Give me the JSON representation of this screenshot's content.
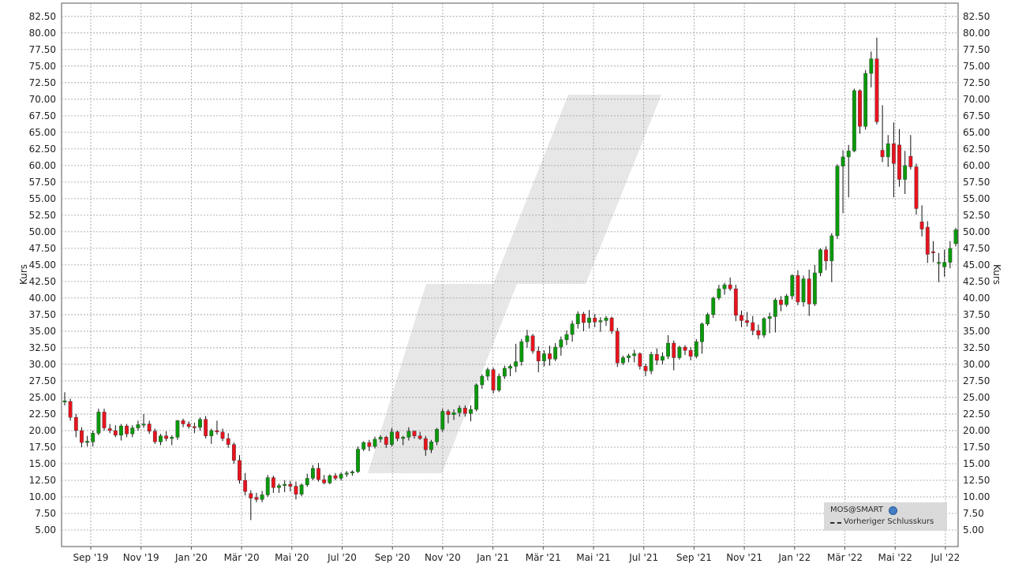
{
  "chart_data": {
    "type": "candlestick",
    "ylabel": "Kurs",
    "ylim": [
      2.5,
      84.5
    ],
    "y_ticks": [
      "5.00",
      "7.50",
      "10.00",
      "12.50",
      "15.00",
      "17.50",
      "20.00",
      "22.50",
      "25.00",
      "27.50",
      "30.00",
      "32.50",
      "35.00",
      "37.50",
      "40.00",
      "42.50",
      "45.00",
      "47.50",
      "50.00",
      "52.50",
      "55.00",
      "57.50",
      "60.00",
      "62.50",
      "65.00",
      "67.50",
      "70.00",
      "72.50",
      "75.00",
      "77.50",
      "80.00",
      "82.50"
    ],
    "x_ticks": [
      "Sep '19",
      "Nov '19",
      "Jan '20",
      "Mär '20",
      "Mai '20",
      "Jul '20",
      "Sep '20",
      "Nov '20",
      "Jan '21",
      "Mär '21",
      "Mai '21",
      "Jul '21",
      "Sep '21",
      "Nov '21",
      "Jan '22",
      "Mär '22",
      "Mai '22",
      "Jul '22"
    ],
    "grid": true,
    "legend_position": "bottom-right",
    "colors": {
      "up": "#0a9a0a",
      "down": "#e8141e",
      "wick": "#111111",
      "grid": "#9a9a9a"
    },
    "candles": [
      [
        24.3,
        25.8,
        23.8,
        24.5
      ],
      [
        24.4,
        24.8,
        21.5,
        22.0
      ],
      [
        22.0,
        22.5,
        19.0,
        20.0
      ],
      [
        20.0,
        20.5,
        17.5,
        18.2
      ],
      [
        18.2,
        19.2,
        17.6,
        18.4
      ],
      [
        18.3,
        20.0,
        17.6,
        19.6
      ],
      [
        19.6,
        23.3,
        19.3,
        22.8
      ],
      [
        22.8,
        23.3,
        20.0,
        20.4
      ],
      [
        20.3,
        21.0,
        19.6,
        20.0
      ],
      [
        20.0,
        20.8,
        19.0,
        19.3
      ],
      [
        19.3,
        21.0,
        18.5,
        20.7
      ],
      [
        20.7,
        21.0,
        19.0,
        19.5
      ],
      [
        19.5,
        20.8,
        19.0,
        20.4
      ],
      [
        20.4,
        21.5,
        20.0,
        20.9
      ],
      [
        20.9,
        22.5,
        20.4,
        21.0
      ],
      [
        21.0,
        21.5,
        19.5,
        19.9
      ],
      [
        19.9,
        20.3,
        18.0,
        18.3
      ],
      [
        18.3,
        19.5,
        17.8,
        19.2
      ],
      [
        19.2,
        19.9,
        18.4,
        18.8
      ],
      [
        18.8,
        19.3,
        17.8,
        19.0
      ],
      [
        19.0,
        21.6,
        18.6,
        21.5
      ],
      [
        21.5,
        21.8,
        20.5,
        21.0
      ],
      [
        21.0,
        21.4,
        20.3,
        20.6
      ],
      [
        20.6,
        21.2,
        19.6,
        20.5
      ],
      [
        20.5,
        22.0,
        20.0,
        21.7
      ],
      [
        21.7,
        22.2,
        18.8,
        19.2
      ],
      [
        19.2,
        20.3,
        18.0,
        20.0
      ],
      [
        20.0,
        21.5,
        19.4,
        19.8
      ],
      [
        19.8,
        20.3,
        18.4,
        18.8
      ],
      [
        18.8,
        19.6,
        17.4,
        17.9
      ],
      [
        17.9,
        18.2,
        15.0,
        15.5
      ],
      [
        15.5,
        16.3,
        12.0,
        12.5
      ],
      [
        12.5,
        13.6,
        10.2,
        10.8
      ],
      [
        10.5,
        11.0,
        6.5,
        9.8
      ],
      [
        9.9,
        10.6,
        9.2,
        9.6
      ],
      [
        9.6,
        10.9,
        9.2,
        10.3
      ],
      [
        10.3,
        13.3,
        10.0,
        12.9
      ],
      [
        12.9,
        13.2,
        10.6,
        11.4
      ],
      [
        11.4,
        12.0,
        10.6,
        11.7
      ],
      [
        11.7,
        12.5,
        10.7,
        11.9
      ],
      [
        11.9,
        12.4,
        10.8,
        11.6
      ],
      [
        11.6,
        12.3,
        9.6,
        10.4
      ],
      [
        10.4,
        12.0,
        10.1,
        11.8
      ],
      [
        11.8,
        13.5,
        11.5,
        12.8
      ],
      [
        12.8,
        14.8,
        12.5,
        14.3
      ],
      [
        14.3,
        15.1,
        12.3,
        12.6
      ],
      [
        12.6,
        13.3,
        11.9,
        12.1
      ],
      [
        12.1,
        13.4,
        11.9,
        13.2
      ],
      [
        13.2,
        13.6,
        12.5,
        12.8
      ],
      [
        12.8,
        13.7,
        12.5,
        13.4
      ],
      [
        13.4,
        13.9,
        13.0,
        13.6
      ],
      [
        13.6,
        14.0,
        13.2,
        13.8
      ],
      [
        13.8,
        17.6,
        13.6,
        17.2
      ],
      [
        17.2,
        18.4,
        16.9,
        18.2
      ],
      [
        18.2,
        18.6,
        16.9,
        17.6
      ],
      [
        17.6,
        19.1,
        17.3,
        18.7
      ],
      [
        18.7,
        19.3,
        18.2,
        19.0
      ],
      [
        19.0,
        19.2,
        17.4,
        17.9
      ],
      [
        17.9,
        20.4,
        17.6,
        19.8
      ],
      [
        19.8,
        20.0,
        18.4,
        18.8
      ],
      [
        18.8,
        19.2,
        17.8,
        19.0
      ],
      [
        19.0,
        20.5,
        18.5,
        19.9
      ],
      [
        19.9,
        20.0,
        18.8,
        19.2
      ],
      [
        19.2,
        19.8,
        18.6,
        18.8
      ],
      [
        18.8,
        19.2,
        16.2,
        17.1
      ],
      [
        17.1,
        18.6,
        16.6,
        18.3
      ],
      [
        18.3,
        20.4,
        17.8,
        20.2
      ],
      [
        20.2,
        23.3,
        19.8,
        22.9
      ],
      [
        22.9,
        23.2,
        21.1,
        22.4
      ],
      [
        22.4,
        23.2,
        21.6,
        22.7
      ],
      [
        22.7,
        23.8,
        22.1,
        23.4
      ],
      [
        23.4,
        23.8,
        22.1,
        22.6
      ],
      [
        22.6,
        23.8,
        21.4,
        23.2
      ],
      [
        23.2,
        27.1,
        22.9,
        26.9
      ],
      [
        26.9,
        28.5,
        26.3,
        28.2
      ],
      [
        28.2,
        29.5,
        27.6,
        29.2
      ],
      [
        29.2,
        29.5,
        25.6,
        26.1
      ],
      [
        26.1,
        28.6,
        25.8,
        28.2
      ],
      [
        28.2,
        29.8,
        27.8,
        29.4
      ],
      [
        29.4,
        30.0,
        28.2,
        29.7
      ],
      [
        29.7,
        33.1,
        28.8,
        30.4
      ],
      [
        30.4,
        33.8,
        29.8,
        33.4
      ],
      [
        33.4,
        35.2,
        32.5,
        34.3
      ],
      [
        34.3,
        34.6,
        31.6,
        32.0
      ],
      [
        32.0,
        32.7,
        28.8,
        30.5
      ],
      [
        30.5,
        32.1,
        29.7,
        31.6
      ],
      [
        31.6,
        32.8,
        29.8,
        30.8
      ],
      [
        30.8,
        33.2,
        30.5,
        32.6
      ],
      [
        32.6,
        34.2,
        31.3,
        33.7
      ],
      [
        33.7,
        35.1,
        32.9,
        34.5
      ],
      [
        34.5,
        36.6,
        33.4,
        36.1
      ],
      [
        36.1,
        38.0,
        35.4,
        37.6
      ],
      [
        37.6,
        37.9,
        35.0,
        36.3
      ],
      [
        36.3,
        38.2,
        35.4,
        37.0
      ],
      [
        37.0,
        37.6,
        35.6,
        36.4
      ],
      [
        36.4,
        37.1,
        34.9,
        36.6
      ],
      [
        36.6,
        37.3,
        35.8,
        37.0
      ],
      [
        37.0,
        37.2,
        34.6,
        35.0
      ],
      [
        35.0,
        35.5,
        29.6,
        30.2
      ],
      [
        30.2,
        31.3,
        29.9,
        31.0
      ],
      [
        31.0,
        31.6,
        30.3,
        31.3
      ],
      [
        31.3,
        32.2,
        30.3,
        31.6
      ],
      [
        31.6,
        31.8,
        29.2,
        29.7
      ],
      [
        29.7,
        30.1,
        28.2,
        29.0
      ],
      [
        29.0,
        31.9,
        28.5,
        31.5
      ],
      [
        31.5,
        32.4,
        29.9,
        30.6
      ],
      [
        30.6,
        31.8,
        30.0,
        31.2
      ],
      [
        31.2,
        34.4,
        30.8,
        33.2
      ],
      [
        33.2,
        33.6,
        29.1,
        31.0
      ],
      [
        31.0,
        32.8,
        30.7,
        32.6
      ],
      [
        32.6,
        32.9,
        31.4,
        32.1
      ],
      [
        32.1,
        32.6,
        30.6,
        31.2
      ],
      [
        31.2,
        33.8,
        30.9,
        33.4
      ],
      [
        33.4,
        36.3,
        31.6,
        36.1
      ],
      [
        36.1,
        37.8,
        35.8,
        37.5
      ],
      [
        37.5,
        40.2,
        37.0,
        40.0
      ],
      [
        40.0,
        42.0,
        39.7,
        41.4
      ],
      [
        41.4,
        42.3,
        40.5,
        42.0
      ],
      [
        42.0,
        43.1,
        41.1,
        41.4
      ],
      [
        41.4,
        42.0,
        36.5,
        37.4
      ],
      [
        37.4,
        38.1,
        35.6,
        36.6
      ],
      [
        36.6,
        37.9,
        35.7,
        36.3
      ],
      [
        36.3,
        37.3,
        34.4,
        35.1
      ],
      [
        35.1,
        36.0,
        33.8,
        34.4
      ],
      [
        34.4,
        37.1,
        34.0,
        36.9
      ],
      [
        36.9,
        37.8,
        34.7,
        37.2
      ],
      [
        37.2,
        40.0,
        34.8,
        39.7
      ],
      [
        39.7,
        40.3,
        38.0,
        39.0
      ],
      [
        39.0,
        40.6,
        38.7,
        40.3
      ],
      [
        40.3,
        43.6,
        39.8,
        43.4
      ],
      [
        43.4,
        44.2,
        38.9,
        39.4
      ],
      [
        39.4,
        43.4,
        38.7,
        42.9
      ],
      [
        42.9,
        44.3,
        37.3,
        39.1
      ],
      [
        39.1,
        45.0,
        38.8,
        43.8
      ],
      [
        43.8,
        47.5,
        43.3,
        47.3
      ],
      [
        47.3,
        47.8,
        44.2,
        45.6
      ],
      [
        45.6,
        49.8,
        42.4,
        49.4
      ],
      [
        49.4,
        60.2,
        48.9,
        59.9
      ],
      [
        59.9,
        62.3,
        52.8,
        61.3
      ],
      [
        61.3,
        63.1,
        55.2,
        62.2
      ],
      [
        62.2,
        71.6,
        62.0,
        71.3
      ],
      [
        71.3,
        71.5,
        64.8,
        65.9
      ],
      [
        65.9,
        74.4,
        65.4,
        73.9
      ],
      [
        73.9,
        77.2,
        71.8,
        76.1
      ],
      [
        76.1,
        79.3,
        66.2,
        66.6
      ],
      [
        62.3,
        69.1,
        60.5,
        61.3
      ],
      [
        61.3,
        64.6,
        59.8,
        63.3
      ],
      [
        63.3,
        66.5,
        55.2,
        60.3
      ],
      [
        63.1,
        65.5,
        56.8,
        57.9
      ],
      [
        57.9,
        62.2,
        55.7,
        60.0
      ],
      [
        61.4,
        64.6,
        59.4,
        59.8
      ],
      [
        59.8,
        60.3,
        52.6,
        53.5
      ],
      [
        51.5,
        54.0,
        49.3,
        50.4
      ],
      [
        50.7,
        51.6,
        45.3,
        46.6
      ],
      [
        47.0,
        48.6,
        45.4,
        46.9
      ],
      [
        45.4,
        46.8,
        42.4,
        45.4
      ],
      [
        44.7,
        47.3,
        43.2,
        45.4
      ],
      [
        45.4,
        48.6,
        44.5,
        47.5
      ],
      [
        48.2,
        50.6,
        47.8,
        50.3
      ]
    ]
  },
  "watermark": {
    "source": "MOS@SMART"
  },
  "legend": {
    "title": "MOS@SMART",
    "series": "Vorheriger Schlusskurs"
  }
}
